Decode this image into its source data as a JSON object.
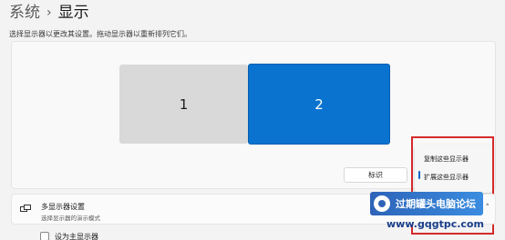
{
  "breadcrumb": {
    "parent": "系统",
    "separator": "›",
    "current": "显示"
  },
  "description": "选择显示器以更改其设置。拖动显示器以重新排列它们。",
  "monitors": [
    {
      "label": "1",
      "selected": false,
      "color": "#d9d9d9"
    },
    {
      "label": "2",
      "selected": true,
      "color": "#0a73d0"
    }
  ],
  "identify_button": "标识",
  "mode_menu": {
    "items": [
      "复制这些显示器",
      "扩展这些显示器"
    ],
    "selected_index": 1
  },
  "multi_display": {
    "title": "多显示器设置",
    "subtitle": "选择显示器的演示模式",
    "icon": "multi-display-icon",
    "chevron": "˄"
  },
  "checkbox_row": {
    "label": "设为主显示器",
    "checked": false
  },
  "watermark": {
    "text": "过期罐头电脑论坛",
    "url": "www.gqgtpc.com"
  },
  "colors": {
    "accent": "#0a73d0",
    "highlight_box": "#d42a2a"
  }
}
